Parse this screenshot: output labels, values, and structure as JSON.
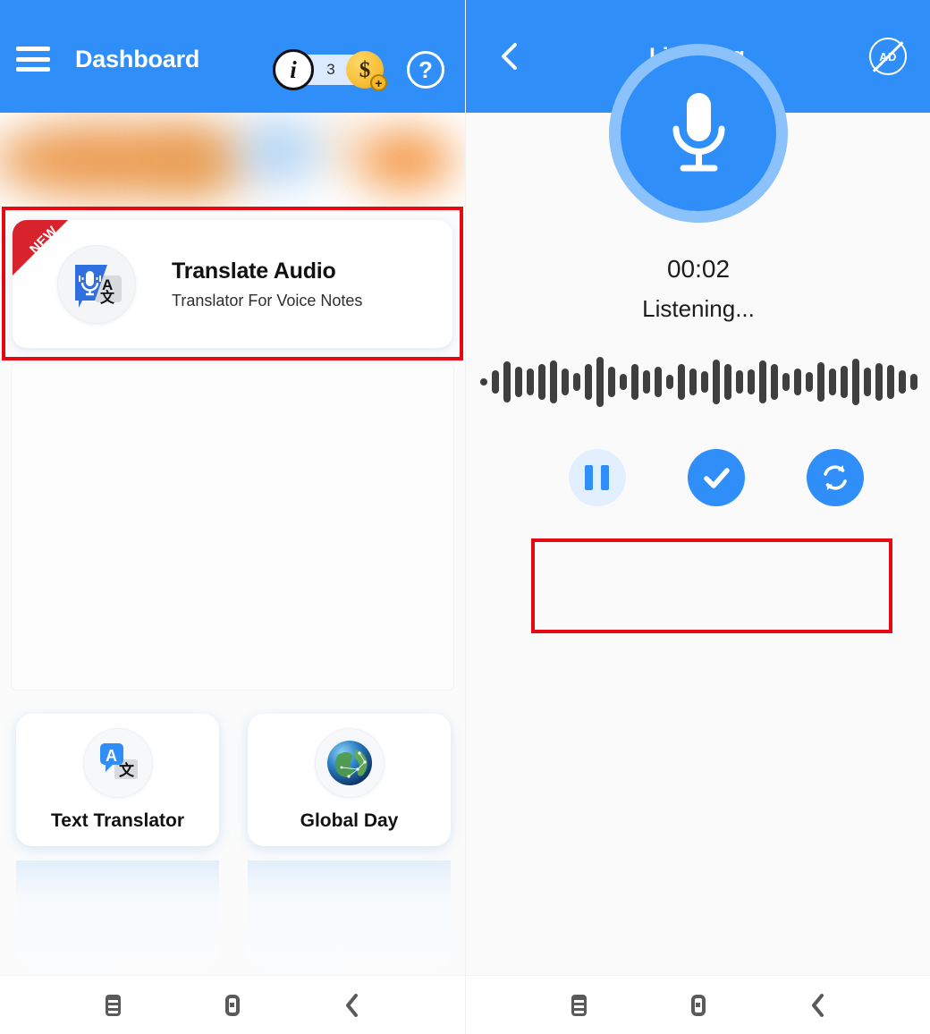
{
  "left_panel": {
    "appbar": {
      "menu_icon": "hamburger-menu-icon",
      "title": "Dashboard",
      "info_icon_label": "i",
      "coin_count": "3",
      "coin_symbol": "$",
      "coin_plus": "+",
      "help_label": "?"
    },
    "ad_banner": {
      "name": "blurred-ad-banner"
    },
    "feature_card": {
      "ribbon": "NEW",
      "title": "Translate Audio",
      "subtitle": "Translator For Voice Notes",
      "icon": "audio-translate-icon",
      "icon_letters": {
        "latin": "A",
        "cjk": "文"
      }
    },
    "tiles": [
      {
        "label": "Text Translator",
        "icon": "text-translate-icon"
      },
      {
        "label": "Global Day",
        "icon": "globe-icon"
      }
    ],
    "navbar": {
      "recents": "recents-icon",
      "home": "home-icon",
      "back": "back-icon"
    }
  },
  "right_panel": {
    "appbar": {
      "back_icon": "back-chevron-icon",
      "title": "Listening",
      "ad_badge": "AD"
    },
    "recorder": {
      "mic_icon": "microphone-icon",
      "timer": "00:02",
      "status": "Listening...",
      "waveform_heights": [
        8,
        26,
        46,
        34,
        30,
        40,
        48,
        30,
        20,
        40,
        56,
        34,
        18,
        40,
        26,
        34,
        16,
        40,
        30,
        24,
        50,
        40,
        26,
        28,
        48,
        40,
        20,
        30,
        22,
        44,
        30,
        36,
        52,
        32,
        42,
        38,
        26,
        18
      ],
      "controls": [
        {
          "name": "pause-button",
          "icon": "pause-icon",
          "state": "inactive"
        },
        {
          "name": "confirm-button",
          "icon": "check-icon",
          "state": "active"
        },
        {
          "name": "restart-button",
          "icon": "refresh-icon",
          "state": "active"
        }
      ]
    },
    "navbar": {
      "recents": "recents-icon",
      "home": "home-icon",
      "back": "back-icon"
    }
  },
  "highlights": [
    {
      "name": "highlight-translate-audio-card",
      "color": "#e50914"
    },
    {
      "name": "highlight-recorder-controls",
      "color": "#e50914"
    }
  ]
}
